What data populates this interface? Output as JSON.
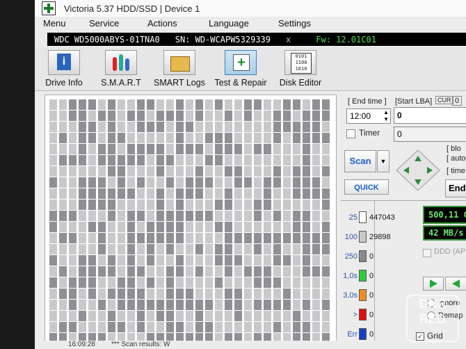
{
  "window": {
    "title": "Victoria 5.37 HDD/SSD | Device 1"
  },
  "menu": [
    "Menu",
    "Service",
    "Actions",
    "Language",
    "Settings"
  ],
  "device": {
    "model": "WDC WD5000ABYS-01TNA0",
    "serial": "SN: WD-WCAPW5329339",
    "close": "x",
    "firmware": "Fw: 12.01C01"
  },
  "toolbar": [
    {
      "label": "Drive Info",
      "icon": "info-icon"
    },
    {
      "label": "S.M.A.R.T",
      "icon": "smart-icon"
    },
    {
      "label": "SMART Logs",
      "icon": "folder-icon"
    },
    {
      "label": "Test & Repair",
      "icon": "repair-icon"
    },
    {
      "label": "Disk Editor",
      "icon": "editor-icon"
    }
  ],
  "controls": {
    "end_time_label": "[ End time ]",
    "end_time_value": "12:00",
    "start_lba_label": "[Start LBA]",
    "cur_label": "CUR",
    "cur_value": "0",
    "start_lba_value": "0",
    "timer_label": "Timer",
    "timer_value": "0",
    "scan_label": "Scan",
    "quick_label": "QUICK",
    "blocks_label": "[ blo",
    "auto_label": "[ auto",
    "time_label": "[ time",
    "end_label": "End"
  },
  "legend": [
    {
      "key": "25",
      "color": "#ffffff",
      "count": "447043"
    },
    {
      "key": "100",
      "color": "#c8c8c8",
      "count": "29898"
    },
    {
      "key": "250",
      "color": "#8a8a8a",
      "count": "0"
    },
    {
      "key": "1,0s",
      "color": "#2ecc40",
      "count": "0"
    },
    {
      "key": "3,0s",
      "color": "#f28c1e",
      "count": "0"
    },
    {
      "key": ">",
      "color": "#e01010",
      "count": "0"
    },
    {
      "key": "Err",
      "color": "#1a40c0",
      "count": "0"
    }
  ],
  "stats": {
    "capacity": "500,11 G",
    "speed": "42 MB/s",
    "ddd_label": "DDD (AP",
    "ignore_label": "Ignore",
    "remap_label": "Remap",
    "grid_label": "Grid"
  },
  "status": {
    "time": "16:09:28",
    "message": "*** Scan results: W"
  },
  "watermark": {
    "line1": "DNR",
    "line2": "RED"
  },
  "colors": {
    "cell_light": "#c9c9cb",
    "cell_dark": "#8f8f95",
    "device_fw": "#4ee04e"
  }
}
